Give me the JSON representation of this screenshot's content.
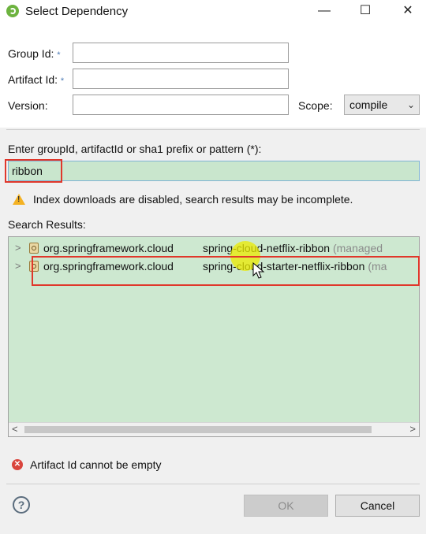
{
  "window": {
    "title": "Select Dependency",
    "minimize_glyph": "—",
    "maximize_glyph": "☐",
    "close_glyph": "✕"
  },
  "form": {
    "group_id_label": "Group Id:",
    "artifact_id_label": "Artifact Id:",
    "version_label": "Version:",
    "required_marker": "*",
    "group_id_value": "",
    "artifact_id_value": "",
    "version_value": "",
    "scope_label": "Scope:",
    "scope_value": "compile"
  },
  "search": {
    "prompt": "Enter groupId, artifactId or sha1 prefix or pattern (*):",
    "query": "ribbon",
    "warning": "Index downloads are disabled, search results may be incomplete.",
    "results_label": "Search Results:"
  },
  "results": [
    {
      "group": "org.springframework.cloud",
      "artifact": "spring-cloud-netflix-ribbon",
      "extra": "(managed"
    },
    {
      "group": "org.springframework.cloud",
      "artifact": "spring-cloud-starter-netflix-ribbon",
      "extra": "(ma"
    }
  ],
  "status": {
    "error": "Artifact Id cannot be empty"
  },
  "buttons": {
    "help_glyph": "?",
    "ok": "OK",
    "cancel": "Cancel"
  },
  "colors": {
    "results_bg": "#cde8d0",
    "highlight_border": "#e0372b",
    "cursor_highlight": "#ebeb00"
  }
}
